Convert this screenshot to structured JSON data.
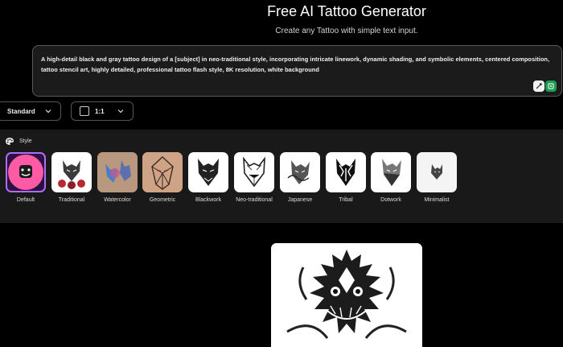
{
  "header": {
    "title": "Free AI Tattoo Generator",
    "subtitle": "Create any Tattoo with simple text input."
  },
  "prompt": {
    "value": "A high-detail black and gray tattoo design of a [subject] in neo-traditional style, incorporating intricate linework, dynamic shading, and symbolic elements, centered composition, tattoo stencil art, highly detailed, professional tattoo flash style, 8K resolution, white background"
  },
  "controls": {
    "quality": "Standard",
    "ratio": "1:1"
  },
  "style_panel": {
    "label": "Style",
    "selected": "Default",
    "styles": [
      {
        "label": "Default",
        "icon": "smiley-icon"
      },
      {
        "label": "Traditional",
        "icon": "wolf-roses-thumbnail"
      },
      {
        "label": "Watercolor",
        "icon": "wolf-watercolor-thumbnail"
      },
      {
        "label": "Geometric",
        "icon": "geometric-wolf-thumbnail"
      },
      {
        "label": "Blackwork",
        "icon": "wolf-thumbnail"
      },
      {
        "label": "Neo-traditional",
        "icon": "wolf-thumbnail"
      },
      {
        "label": "Japanese",
        "icon": "wolf-thumbnail"
      },
      {
        "label": "Tribal",
        "icon": "wolf-thumbnail"
      },
      {
        "label": "Dotwork",
        "icon": "wolf-thumbnail"
      },
      {
        "label": "Minimalist",
        "icon": "wolf-thumbnail"
      }
    ]
  },
  "colors": {
    "accent": "#b26bff",
    "default_tile": "#ff5aa5",
    "panel": "#191919"
  }
}
